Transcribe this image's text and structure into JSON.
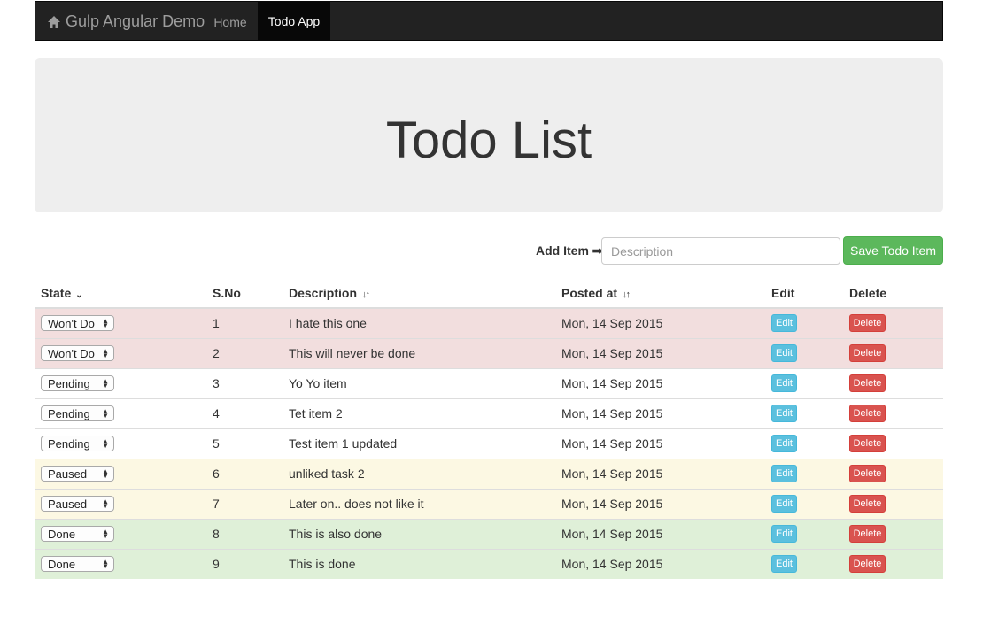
{
  "navbar": {
    "brand": "Gulp Angular Demo",
    "brand_icon": "home-icon",
    "links": [
      {
        "label": "Home",
        "active": false
      },
      {
        "label": "Todo App",
        "active": true
      }
    ]
  },
  "jumbotron": {
    "title": "Todo List"
  },
  "add_form": {
    "label": "Add Item ⇒",
    "placeholder": "Description",
    "value": "",
    "save_label": "Save Todo Item"
  },
  "table": {
    "headers": {
      "state": "State",
      "sno": "S.No",
      "description": "Description",
      "posted_at": "Posted at",
      "edit": "Edit",
      "delete": "Delete"
    },
    "rows": [
      {
        "state": "Won't Do",
        "sno": "1",
        "description": "I hate this one",
        "posted_at": "Mon, 14 Sep 2015",
        "edit": "Edit",
        "delete": "Delete",
        "status": "danger"
      },
      {
        "state": "Won't Do",
        "sno": "2",
        "description": "This will never be done",
        "posted_at": "Mon, 14 Sep 2015",
        "edit": "Edit",
        "delete": "Delete",
        "status": "danger"
      },
      {
        "state": "Pending",
        "sno": "3",
        "description": "Yo Yo item",
        "posted_at": "Mon, 14 Sep 2015",
        "edit": "Edit",
        "delete": "Delete",
        "status": "default"
      },
      {
        "state": "Pending",
        "sno": "4",
        "description": "Tet item 2",
        "posted_at": "Mon, 14 Sep 2015",
        "edit": "Edit",
        "delete": "Delete",
        "status": "default"
      },
      {
        "state": "Pending",
        "sno": "5",
        "description": "Test item 1 updated",
        "posted_at": "Mon, 14 Sep 2015",
        "edit": "Edit",
        "delete": "Delete",
        "status": "default"
      },
      {
        "state": "Paused",
        "sno": "6",
        "description": "unliked task 2",
        "posted_at": "Mon, 14 Sep 2015",
        "edit": "Edit",
        "delete": "Delete",
        "status": "warning"
      },
      {
        "state": "Paused",
        "sno": "7",
        "description": "Later on.. does not like it",
        "posted_at": "Mon, 14 Sep 2015",
        "edit": "Edit",
        "delete": "Delete",
        "status": "warning"
      },
      {
        "state": "Done",
        "sno": "8",
        "description": "This is also done",
        "posted_at": "Mon, 14 Sep 2015",
        "edit": "Edit",
        "delete": "Delete",
        "status": "success"
      },
      {
        "state": "Done",
        "sno": "9",
        "description": "This is done",
        "posted_at": "Mon, 14 Sep 2015",
        "edit": "Edit",
        "delete": "Delete",
        "status": "success"
      }
    ]
  },
  "colors": {
    "navbar_bg": "#222222",
    "danger_row": "#f2dede",
    "warning_row": "#fcf8e3",
    "success_row": "#dff0d8",
    "save_button": "#5cb85c",
    "edit_button": "#5bc0de",
    "delete_button": "#d9534f"
  }
}
